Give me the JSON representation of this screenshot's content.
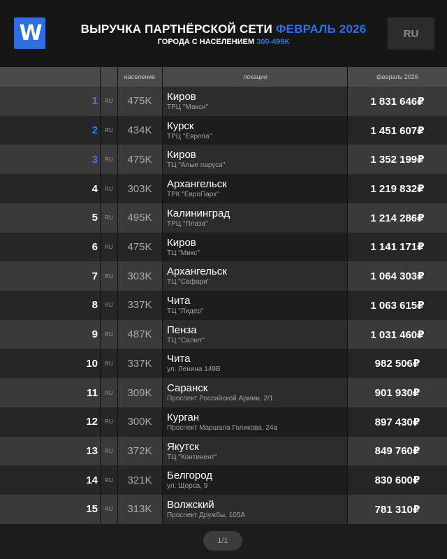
{
  "header": {
    "logo_text": "W",
    "title_main": "ВЫРУЧКА ПАРТНЁРСКОЙ СЕТИ",
    "title_period": "ФЕВРАЛЬ 2026",
    "subtitle_main": "ГОРОДА С НАСЕЛЕНИЕМ",
    "subtitle_range": "300-499К",
    "lang_label": "RU"
  },
  "colors": {
    "accent": "#2f6ee0",
    "top3": "#3b7be8"
  },
  "table": {
    "columns": {
      "population": "население",
      "location": "локации",
      "period": "февраль 2026"
    },
    "rows": [
      {
        "rank": "1",
        "country": "RU",
        "population": "475K",
        "city": "Киров",
        "address": "ТРЦ \"Макси\"",
        "revenue": "1 831 646₽"
      },
      {
        "rank": "2",
        "country": "RU",
        "population": "434K",
        "city": "Курск",
        "address": "ТРЦ \"Европа\"",
        "revenue": "1 451 607₽"
      },
      {
        "rank": "3",
        "country": "RU",
        "population": "475K",
        "city": "Киров",
        "address": "ТЦ \"Алые паруса\"",
        "revenue": "1 352 199₽"
      },
      {
        "rank": "4",
        "country": "RU",
        "population": "303K",
        "city": "Архангельск",
        "address": "ТРК \"ЕвроПарк\"",
        "revenue": "1 219 832₽"
      },
      {
        "rank": "5",
        "country": "RU",
        "population": "495K",
        "city": "Калининград",
        "address": "ТРЦ \"Плаза\"",
        "revenue": "1 214 286₽"
      },
      {
        "rank": "6",
        "country": "RU",
        "population": "475K",
        "city": "Киров",
        "address": "ТЦ \"Микс\"",
        "revenue": "1 141 171₽"
      },
      {
        "rank": "7",
        "country": "RU",
        "population": "303K",
        "city": "Архангельск",
        "address": "ТЦ \"Сафари\"",
        "revenue": "1 064 303₽"
      },
      {
        "rank": "8",
        "country": "RU",
        "population": "337K",
        "city": "Чита",
        "address": "ТЦ \"Лидер\"",
        "revenue": "1 063 615₽"
      },
      {
        "rank": "9",
        "country": "RU",
        "population": "487K",
        "city": "Пенза",
        "address": "ТЦ \"Салют\"",
        "revenue": "1 031 460₽"
      },
      {
        "rank": "10",
        "country": "RU",
        "population": "337K",
        "city": "Чита",
        "address": "ул. Ленина 149В",
        "revenue": "982 506₽"
      },
      {
        "rank": "11",
        "country": "RU",
        "population": "309K",
        "city": "Саранск",
        "address": "Проспект Российской Армии, 2/1",
        "revenue": "901 930₽"
      },
      {
        "rank": "12",
        "country": "RU",
        "population": "300K",
        "city": "Курган",
        "address": "Проспект Маршала Голикова, 24а",
        "revenue": "897 430₽"
      },
      {
        "rank": "13",
        "country": "RU",
        "population": "372K",
        "city": "Якутск",
        "address": "ТЦ \"Континент\"",
        "revenue": "849 760₽"
      },
      {
        "rank": "14",
        "country": "RU",
        "population": "321K",
        "city": "Белгород",
        "address": "ул. Щорса, 9",
        "revenue": "830 600₽"
      },
      {
        "rank": "15",
        "country": "RU",
        "population": "313K",
        "city": "Волжский",
        "address": "Проспект Дружбы, 105А",
        "revenue": "781 310₽"
      }
    ]
  },
  "pagination": {
    "label": "1/1"
  }
}
